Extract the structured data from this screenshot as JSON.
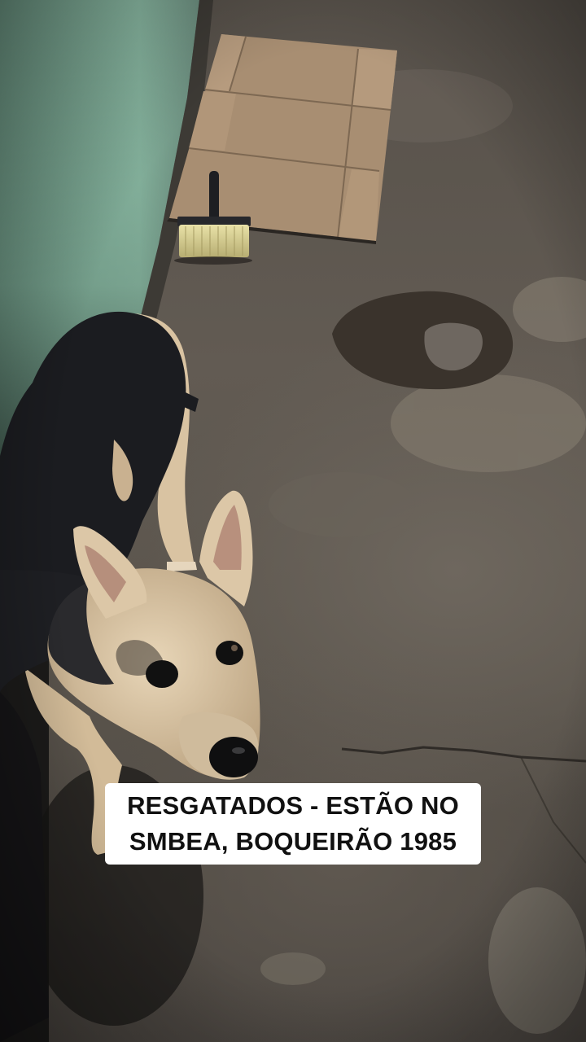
{
  "caption": {
    "line1": "RESGATADOS - ESTÃO NO",
    "line2": "SMBEA, BOQUEIRÃO 1985"
  },
  "scene": {
    "subjects": [
      "dog",
      "cardboard-sheet",
      "brush",
      "floor-patch",
      "green-wall"
    ],
    "colors": {
      "wall": "#8fbfa8",
      "floor": "#5e5850",
      "cardboard": "#a88e72",
      "dog_black": "#1b1c20",
      "dog_tan": "#d9c3a2",
      "caption_bg": "#ffffff",
      "caption_text": "#111111"
    }
  }
}
